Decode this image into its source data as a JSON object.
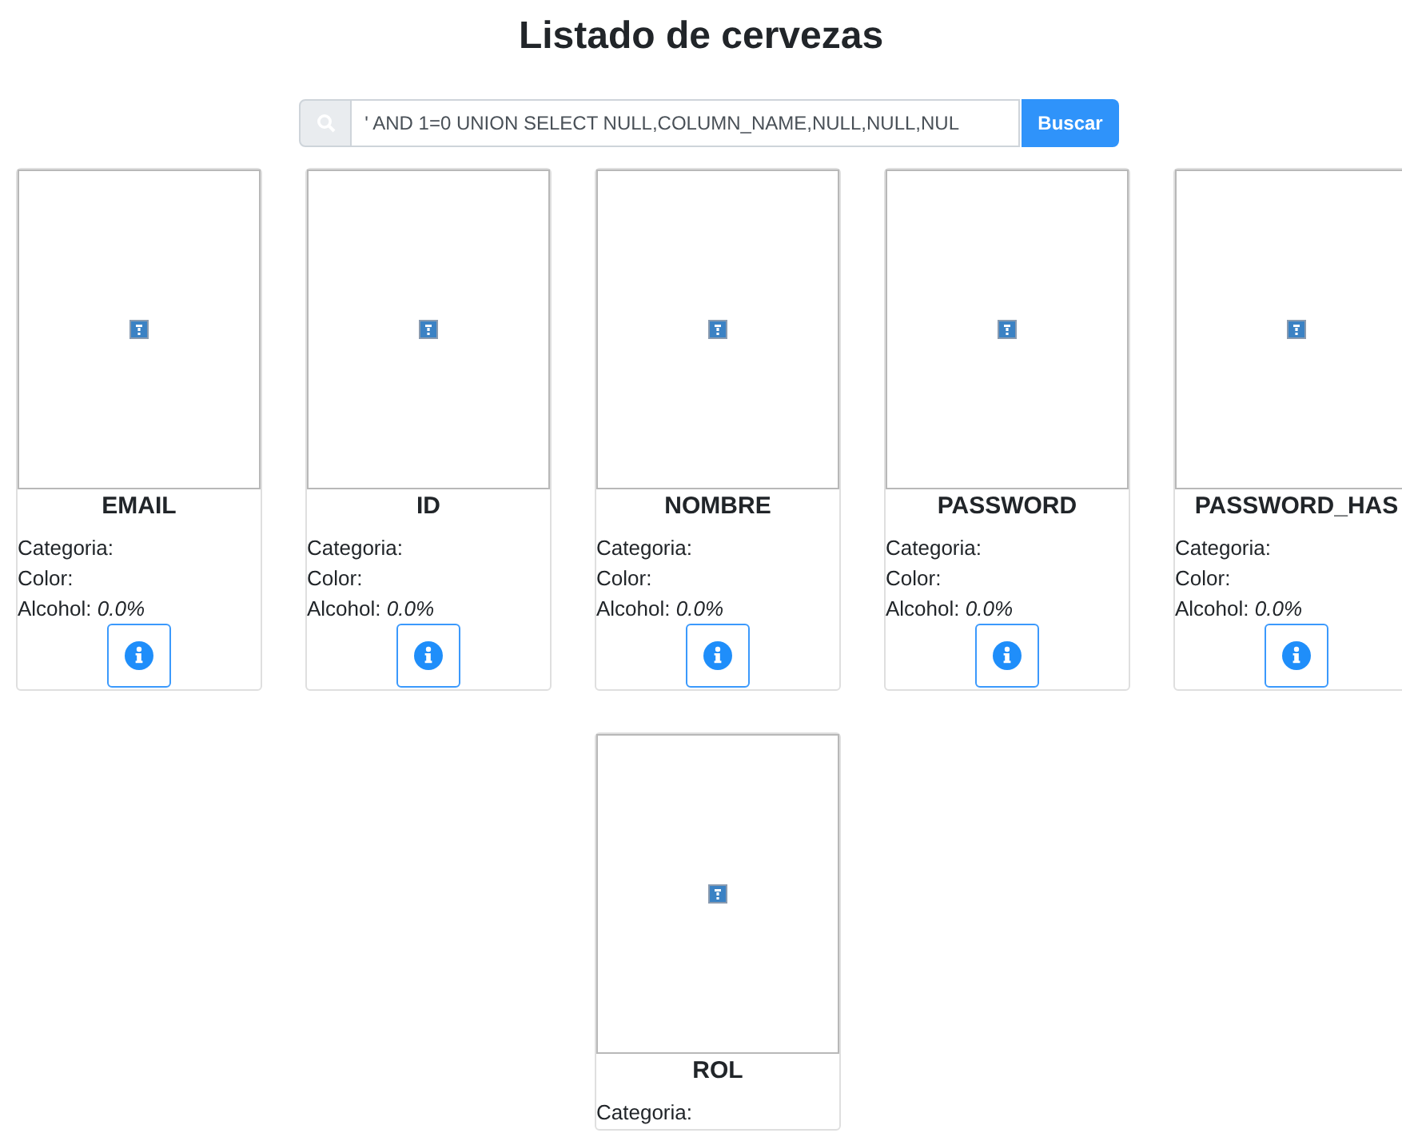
{
  "title": "Listado de cervezas",
  "search": {
    "value": "' AND 1=0 UNION SELECT NULL,COLUMN_NAME,NULL,NULL,NUL",
    "button": "Buscar"
  },
  "cards": [
    {
      "name": "EMAIL",
      "fields": [
        "Categoria:",
        "Color:",
        "Alcohol: *0.0%*"
      ],
      "has_button": true
    },
    {
      "name": "ID",
      "fields": [
        "Categoria:",
        "Color:",
        "Alcohol: *0.0%*"
      ],
      "has_button": true
    },
    {
      "name": "NOMBRE",
      "fields": [
        "Categoria:",
        "Color:",
        "Alcohol: *0.0%*"
      ],
      "has_button": true
    },
    {
      "name": "PASSWORD",
      "fields": [
        "Categoria:",
        "Color:",
        "Alcohol: *0.0%*"
      ],
      "has_button": true
    },
    {
      "name": "PASSWORD_HAS",
      "fields": [
        "Categoria:",
        "Color:",
        "Alcohol: *0.0%*"
      ],
      "has_button": true
    },
    {
      "name": "ROL",
      "fields": [
        "Categoria:"
      ],
      "has_button": false
    }
  ]
}
